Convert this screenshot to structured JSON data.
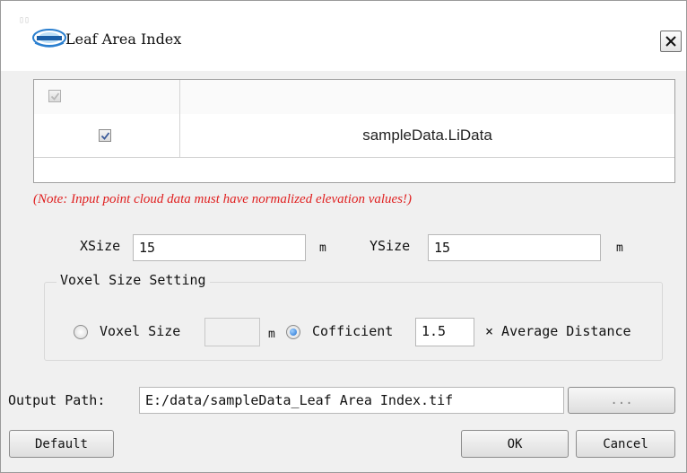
{
  "window": {
    "title": "Leaf Area Index"
  },
  "table": {
    "rows": [
      {
        "checked": true,
        "name": "sampleData.LiData"
      }
    ]
  },
  "note": "(Note: Input point cloud data must have normalized elevation values!)",
  "size": {
    "xsize_label": "XSize",
    "xsize_value": "15",
    "xsize_unit": "m",
    "ysize_label": "YSize",
    "ysize_value": "15",
    "ysize_unit": "m"
  },
  "voxel": {
    "group_title": "Voxel Size Setting",
    "voxel_size_label": "Voxel Size",
    "voxel_size_value": "",
    "voxel_size_unit": "m",
    "coefficient_label": "Cofficient",
    "coefficient_value": "1.5",
    "multiplier_suffix": "× Average Distance",
    "selected": "coefficient"
  },
  "output": {
    "label": "Output Path:",
    "value": "E:/data/sampleData_Leaf Area Index.tif",
    "browse_label": "..."
  },
  "buttons": {
    "default": "Default",
    "ok": "OK",
    "cancel": "Cancel"
  },
  "icons": {
    "close": "close-icon",
    "logo": "app-logo-icon",
    "checkbox": "checkmark-icon"
  }
}
